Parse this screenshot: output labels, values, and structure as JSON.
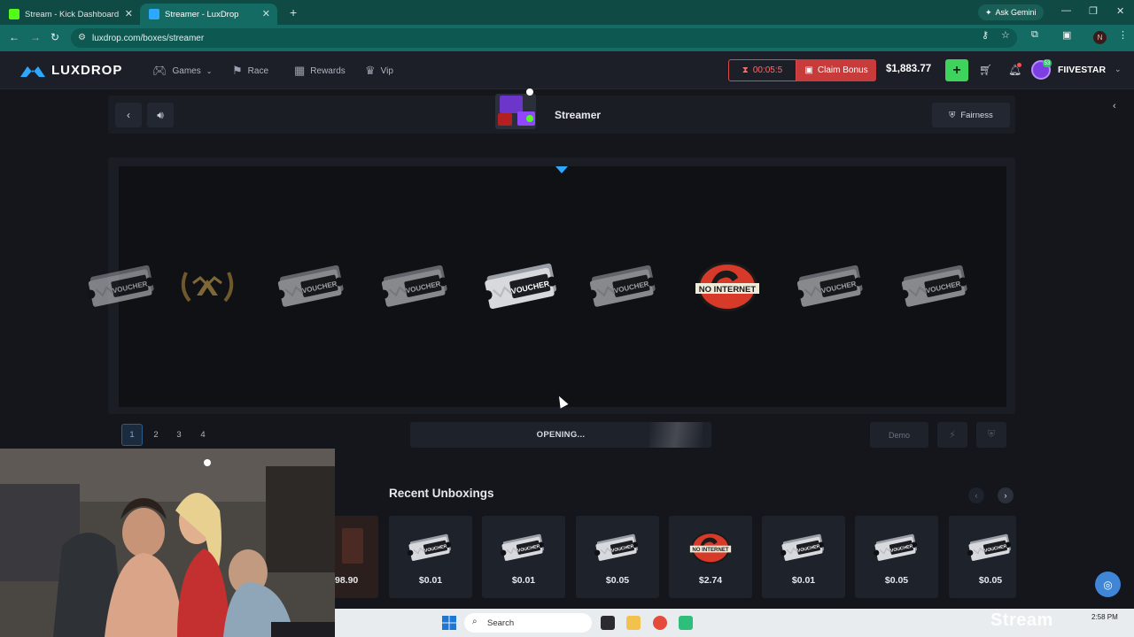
{
  "browser": {
    "tabs": [
      {
        "title": "Stream - Kick Dashboard",
        "favicon_color": "#53fc18"
      },
      {
        "title": "Streamer - LuxDrop",
        "favicon_color": "#2da8ff"
      }
    ],
    "gemini_label": "Ask Gemini",
    "url": "luxdrop.com/boxes/streamer",
    "profile_initial": "N"
  },
  "site": {
    "logo_text": "LUXDROP",
    "nav": [
      {
        "label": "Games",
        "icon": "gamepad-icon"
      },
      {
        "label": "Race",
        "icon": "race-flag-icon"
      },
      {
        "label": "Rewards",
        "icon": "gift-icon"
      },
      {
        "label": "Vip",
        "icon": "crown-icon"
      }
    ],
    "timer": "00:05:5",
    "claim_label": "Claim Bonus",
    "balance": "$1,883.77",
    "user_level": "53",
    "username": "FIIVESTAR",
    "accent_color": "#2da8ff",
    "claim_color": "#c73b3b",
    "deposit_color": "#3ed35c"
  },
  "box": {
    "title": "Streamer",
    "fairness_label": "Fairness"
  },
  "reel": {
    "items": [
      "voucher",
      "laurel-logo",
      "voucher",
      "voucher",
      "voucher",
      "voucher",
      "no-internet",
      "voucher",
      "voucher"
    ]
  },
  "controls": {
    "quantities": [
      "1",
      "2",
      "3",
      "4"
    ],
    "selected_quantity": "1",
    "opening_label": "OPENING...",
    "demo_label": "Demo"
  },
  "recent": {
    "title": "Recent Unboxings",
    "partial_price": "98.90",
    "cards": [
      {
        "item": "voucher",
        "price": "$0.01"
      },
      {
        "item": "voucher",
        "price": "$0.01"
      },
      {
        "item": "voucher",
        "price": "$0.05"
      },
      {
        "item": "no-internet",
        "price": "$2.74"
      },
      {
        "item": "voucher",
        "price": "$0.01"
      },
      {
        "item": "voucher",
        "price": "$0.05"
      },
      {
        "item": "voucher",
        "price": "$0.05"
      }
    ]
  },
  "taskbar": {
    "search_placeholder": "Search",
    "clock_time": "2:58 PM"
  },
  "overlay": {
    "watermark": "Stream"
  }
}
